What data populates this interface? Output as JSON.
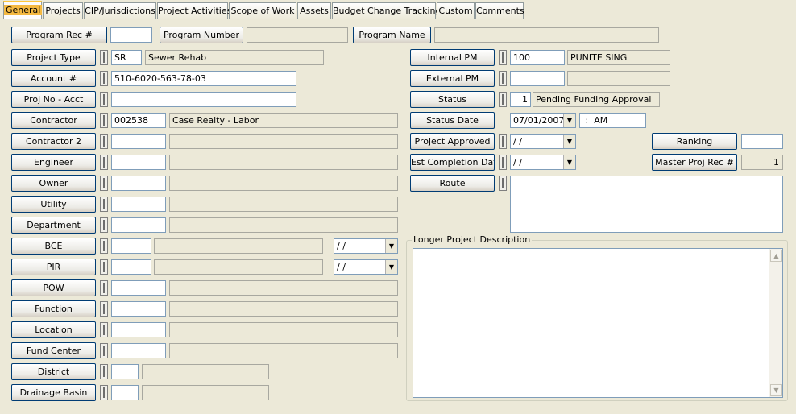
{
  "tabs": [
    "General",
    "Projects",
    "CIP/Jurisdictions",
    "Project Activities",
    "Scope of Work",
    "Assets",
    "Budget Change Tracking",
    "Custom",
    "Comments"
  ],
  "top_row": {
    "program_rec_label": "Program Rec #",
    "program_rec_value": "",
    "program_number_label": "Program Number",
    "program_number_value": "",
    "program_name_label": "Program Name",
    "program_name_value": ""
  },
  "left": {
    "project_type": {
      "label": "Project Type",
      "code": "SR",
      "desc": "Sewer Rehab"
    },
    "account": {
      "label": "Account #",
      "value": "510-6020-563-78-03"
    },
    "proj_no": {
      "label": "Proj No - Acct",
      "value": ""
    },
    "contractor": {
      "label": "Contractor",
      "code": "002538",
      "desc": "Case Realty - Labor"
    },
    "contractor2": {
      "label": "Contractor 2",
      "code": "",
      "desc": ""
    },
    "engineer": {
      "label": "Engineer",
      "code": "",
      "desc": ""
    },
    "owner": {
      "label": "Owner",
      "code": "",
      "desc": ""
    },
    "utility": {
      "label": "Utility",
      "code": "",
      "desc": ""
    },
    "department": {
      "label": "Department",
      "code": "",
      "desc": ""
    },
    "bce": {
      "label": "BCE",
      "code": "",
      "desc": "",
      "date": "/ /"
    },
    "pir": {
      "label": "PIR",
      "code": "",
      "desc": "",
      "date": "/ /"
    },
    "pow": {
      "label": "POW",
      "code": "",
      "desc": ""
    },
    "function": {
      "label": "Function",
      "code": "",
      "desc": ""
    },
    "location": {
      "label": "Location",
      "code": "",
      "desc": ""
    },
    "fund_center": {
      "label": "Fund Center",
      "code": "",
      "desc": ""
    },
    "district": {
      "label": "District",
      "code": "",
      "desc": ""
    },
    "drainage_basin": {
      "label": "Drainage Basin",
      "code": "",
      "desc": ""
    }
  },
  "right": {
    "internal_pm": {
      "label": "Internal PM",
      "code": "100",
      "desc": "PUNITE SING"
    },
    "external_pm": {
      "label": "External PM",
      "code": "",
      "desc": ""
    },
    "status": {
      "label": "Status",
      "code": "1",
      "desc": "Pending Funding Approval"
    },
    "status_date": {
      "label": "Status Date",
      "date": "07/01/2007",
      "time": " :  AM"
    },
    "project_approved": {
      "label": "Project Approved",
      "date": "/ /"
    },
    "est_completion": {
      "label": "Est Completion Date",
      "date": "/ /"
    },
    "ranking": {
      "label": "Ranking",
      "value": ""
    },
    "master_proj_rec": {
      "label": "Master Proj Rec #",
      "value": "1"
    },
    "route": {
      "label": "Route",
      "value": ""
    },
    "longer_desc": {
      "label": "Longer Project Description",
      "value": ""
    }
  }
}
